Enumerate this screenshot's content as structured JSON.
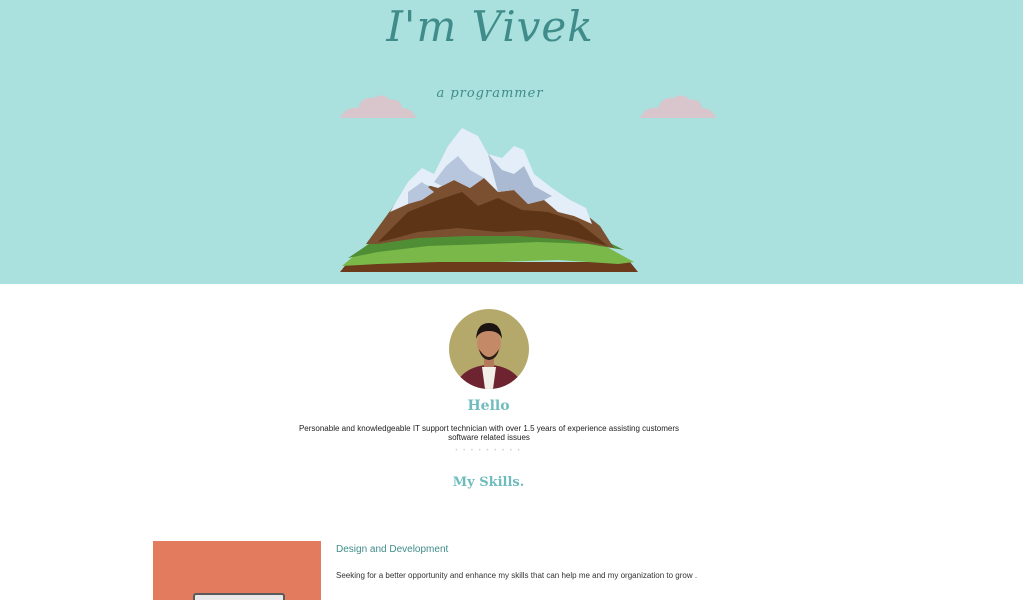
{
  "hero": {
    "title": "I'm Vivek",
    "subtitle": "a programmer",
    "background_color": "#aae0de",
    "text_color": "#3f8c8a"
  },
  "about": {
    "greeting": "Hello",
    "bio": "Personable and knowledgeable IT support technician with over 1.5 years of experience assisting customers software related issues",
    "separator": "• • • • • • • • •",
    "skills_title": "My Skills.",
    "accent_color": "#6fbcbf"
  },
  "skills": [
    {
      "heading": "Design and Development",
      "description": "Seeking for a better opportunity and enhance my skills that can help me and my organization to grow .",
      "card_color": "#e37b5f",
      "icon": "monitor-icon"
    }
  ]
}
